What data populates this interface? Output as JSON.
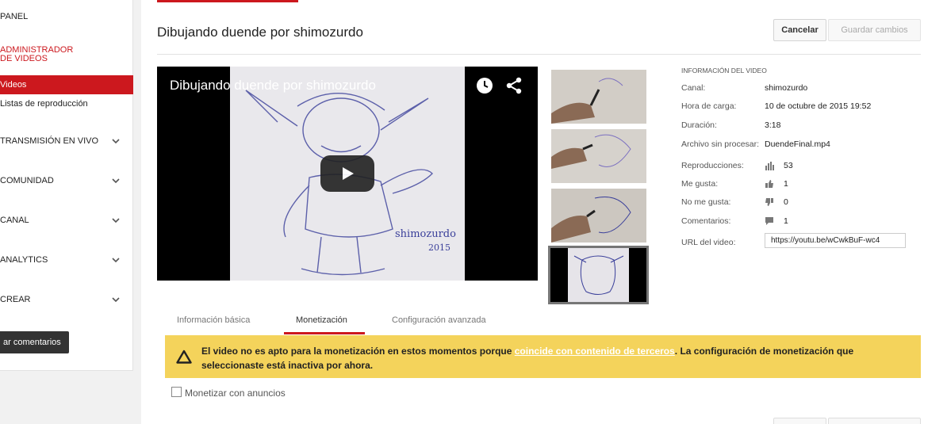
{
  "sidebar": {
    "panel": "PANEL",
    "video_manager": "ADMINISTRADOR DE VIDEOS",
    "videos": "Videos",
    "playlists": "Listas de reproducción",
    "live": "TRANSMISIÓN EN VIVO",
    "community": "COMUNIDAD",
    "channel": "CANAL",
    "analytics": "ANALYTICS",
    "create": "CREAR",
    "feedback_button": "ar comentarios"
  },
  "header": {
    "title": "Dibujando duende por shimozurdo",
    "cancel_label": "Cancelar",
    "save_label": "Guardar cambios"
  },
  "player": {
    "title": "Dibujando duende por shimozurdo"
  },
  "info": {
    "heading": "INFORMACIÓN DEL VIDEO",
    "channel_label": "Canal:",
    "channel_value": "shimozurdo",
    "upload_label": "Hora de carga:",
    "upload_value": "10 de octubre de 2015 19:52",
    "duration_label": "Duración:",
    "duration_value": "3:18",
    "file_label": "Archivo sin procesar:",
    "file_value": "DuendeFinal.mp4",
    "views_label": "Reproducciones:",
    "views_value": "53",
    "likes_label": "Me gusta:",
    "likes_value": "1",
    "dislikes_label": "No me gusta:",
    "dislikes_value": "0",
    "comments_label": "Comentarios:",
    "comments_value": "1",
    "url_label": "URL del video:",
    "url_value": "https://youtu.be/wCwkBuF-wc4"
  },
  "tabs": {
    "basic": "Información básica",
    "monetization": "Monetización",
    "advanced": "Configuración avanzada"
  },
  "warning": {
    "text_before": "El video no es apto para la monetización en estos momentos porque ",
    "link": "coincide con contenido de terceros",
    "text_after": ". La configuración de monetización que seleccionaste está inactiva por ahora."
  },
  "monetize": {
    "label": "Monetizar con anuncios"
  },
  "colors": {
    "accent": "#cc181e",
    "warning_bg": "#f4d35b"
  }
}
